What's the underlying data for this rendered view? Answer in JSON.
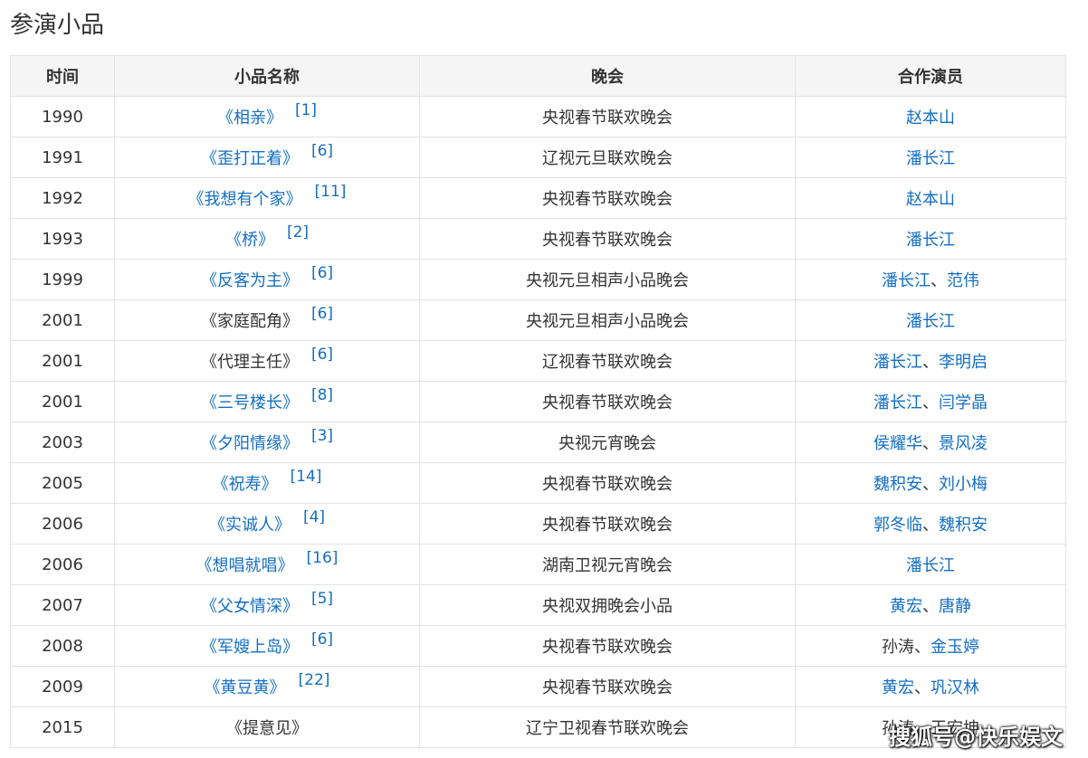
{
  "section_title": "参演小品",
  "headers": {
    "year": "时间",
    "name": "小品名称",
    "gala": "晚会",
    "cast": "合作演员"
  },
  "rows": [
    {
      "year": "1990",
      "name": "《相亲》",
      "ref": "[1]",
      "gala": "央视春节联欢晚会",
      "cast": [
        {
          "text": "赵本山",
          "link": true
        }
      ]
    },
    {
      "year": "1991",
      "name": "《歪打正着》",
      "ref": "[6]",
      "gala": "辽视元旦联欢晚会",
      "cast": [
        {
          "text": "潘长江",
          "link": true
        }
      ]
    },
    {
      "year": "1992",
      "name": "《我想有个家》",
      "ref": "[11]",
      "gala": "央视春节联欢晚会",
      "cast": [
        {
          "text": "赵本山",
          "link": true
        }
      ]
    },
    {
      "year": "1993",
      "name": "《桥》",
      "ref": "[2]",
      "gala": "央视春节联欢晚会",
      "cast": [
        {
          "text": "潘长江",
          "link": true
        }
      ]
    },
    {
      "year": "1999",
      "name": "《反客为主》",
      "ref": "[6]",
      "gala": "央视元旦相声小品晚会",
      "cast": [
        {
          "text": "潘长江",
          "link": true
        },
        {
          "text": "范伟",
          "link": true
        }
      ]
    },
    {
      "year": "2001",
      "name": "《家庭配角》",
      "ref": "[6]",
      "name_plain": true,
      "gala": "央视元旦相声小品晚会",
      "cast": [
        {
          "text": "潘长江",
          "link": true
        }
      ]
    },
    {
      "year": "2001",
      "name": "《代理主任》",
      "ref": "[6]",
      "name_plain": true,
      "gala": "辽视春节联欢晚会",
      "cast": [
        {
          "text": "潘长江",
          "link": true
        },
        {
          "text": "李明启",
          "link": true
        }
      ]
    },
    {
      "year": "2001",
      "name": "《三号楼长》",
      "ref": "[8]",
      "gala": "央视春节联欢晚会",
      "cast": [
        {
          "text": "潘长江",
          "link": true
        },
        {
          "text": "闫学晶",
          "link": true
        }
      ]
    },
    {
      "year": "2003",
      "name": "《夕阳情缘》",
      "ref": "[3]",
      "gala": "央视元宵晚会",
      "cast": [
        {
          "text": "侯耀华",
          "link": true
        },
        {
          "text": "景风凌",
          "link": true
        }
      ]
    },
    {
      "year": "2005",
      "name": "《祝寿》",
      "ref": "[14]",
      "gala": "央视春节联欢晚会",
      "cast": [
        {
          "text": "魏积安",
          "link": true
        },
        {
          "text": "刘小梅",
          "link": true
        }
      ]
    },
    {
      "year": "2006",
      "name": "《实诚人》",
      "ref": "[4]",
      "gala": "央视春节联欢晚会",
      "cast": [
        {
          "text": "郭冬临",
          "link": true
        },
        {
          "text": "魏积安",
          "link": true
        }
      ]
    },
    {
      "year": "2006",
      "name": "《想唱就唱》",
      "ref": "[16]",
      "gala": "湖南卫视元宵晚会",
      "cast": [
        {
          "text": "潘长江",
          "link": true
        }
      ]
    },
    {
      "year": "2007",
      "name": "《父女情深》",
      "ref": "[5]",
      "gala": "央视双拥晚会小品",
      "cast": [
        {
          "text": "黄宏",
          "link": true
        },
        {
          "text": "唐静",
          "link": true
        }
      ]
    },
    {
      "year": "2008",
      "name": "《军嫂上岛》",
      "ref": "[6]",
      "gala": "央视春节联欢晚会",
      "cast": [
        {
          "text": "孙涛",
          "link": false
        },
        {
          "text": "金玉婷",
          "link": true
        }
      ]
    },
    {
      "year": "2009",
      "name": "《黄豆黄》",
      "ref": "[22]",
      "gala": "央视春节联欢晚会",
      "cast": [
        {
          "text": "黄宏",
          "link": true
        },
        {
          "text": "巩汉林",
          "link": true
        }
      ]
    },
    {
      "year": "2015",
      "name": "《提意见》",
      "ref": "",
      "name_plain": true,
      "gala": "辽宁卫视春节联欢晚会",
      "cast": [
        {
          "text": "孙涛",
          "link": false
        },
        {
          "text": "王宏坤",
          "link": false
        }
      ]
    }
  ],
  "separator": "、",
  "watermark": "搜狐号@快乐娱文"
}
